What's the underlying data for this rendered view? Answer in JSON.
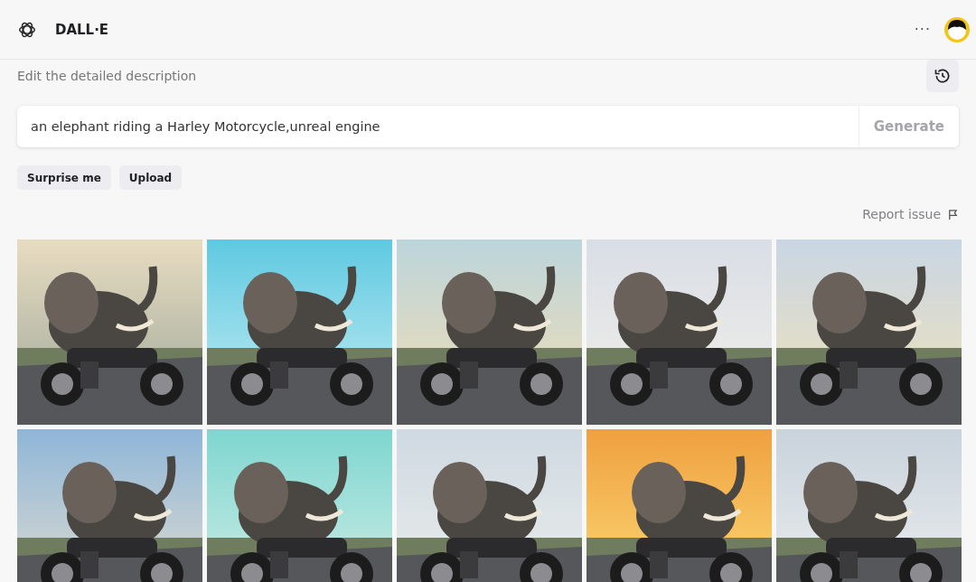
{
  "header": {
    "title": "DALL·E",
    "menu": "···"
  },
  "prompt_label": "Edit the detailed description",
  "prompt": {
    "value": "an elephant riding a Harley Motorcycle,unreal engine",
    "button": "Generate",
    "disabled": true
  },
  "actions": [
    "Surprise me",
    "Upload"
  ],
  "report": "Report issue"
}
